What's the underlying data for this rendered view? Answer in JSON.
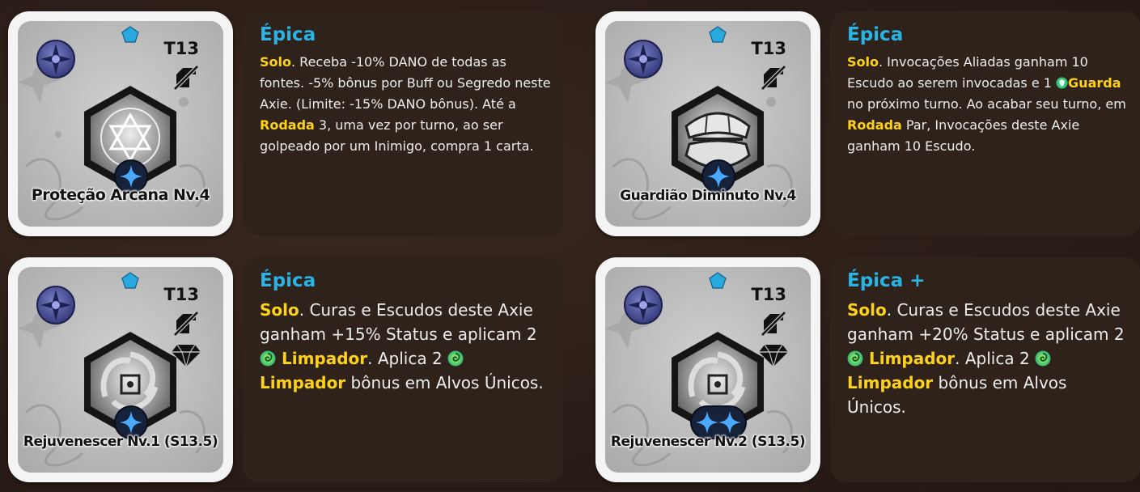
{
  "cards": [
    {
      "name": "Proteção Arcana Nv.4",
      "tier": "T13",
      "rarity": "Épica",
      "art_icon": "star-of-david-icon",
      "level_dots": 1,
      "desc": [
        {
          "t": "Solo",
          "k": true
        },
        {
          "t": ". Receba -10% DANO de todas as fontes. -5% bônus por Buff ou Segredo neste Axie. (Limite: -15% DANO bônus). Até a "
        },
        {
          "t": "Rodada",
          "k": true
        },
        {
          "t": " 3, uma vez por turno, ao ser golpeado por um Inimigo, compra 1 carta."
        }
      ]
    },
    {
      "name": "Guardião Diminuto Nv.4",
      "tier": "T13",
      "rarity": "Épica",
      "art_icon": "shell-mouth-icon",
      "level_dots": 1,
      "desc": [
        {
          "t": "Solo",
          "k": true
        },
        {
          "t": ". Invocações Aliadas ganham 10 Escudo ao serem invocadas e 1 "
        },
        {
          "icon": "guard-icon"
        },
        {
          "t": "Guarda",
          "k": true
        },
        {
          "t": " no próximo turno. Ao acabar seu turno, em "
        },
        {
          "t": "Rodada",
          "k": true
        },
        {
          "t": " Par, Invocações deste Axie ganham 10 Escudo."
        }
      ]
    },
    {
      "name": "Rejuvenescer Nv.1 (S13.5)",
      "tier": "T13",
      "rarity": "Épica",
      "art_icon": "swirl-vortex-icon",
      "level_dots": 1,
      "desc": [
        {
          "t": "Solo",
          "k": true
        },
        {
          "t": ". Curas e Escudos deste Axie ganham +15% Status e aplicam 2 "
        },
        {
          "icon": "cleanse-icon"
        },
        {
          "t": " Limpador",
          "k": true
        },
        {
          "t": ". Aplica 2 "
        },
        {
          "icon": "cleanse-icon"
        },
        {
          "t": " Limpador",
          "k": true
        },
        {
          "t": " bônus em Alvos Únicos."
        }
      ]
    },
    {
      "name": "Rejuvenescer Nv.2 (S13.5)",
      "tier": "T13",
      "rarity": "Épica +",
      "art_icon": "swirl-vortex-icon",
      "level_dots": 2,
      "desc": [
        {
          "t": "Solo",
          "k": true
        },
        {
          "t": ". Curas e Escudos deste Axie ganham +20% Status e aplicam 2 "
        },
        {
          "icon": "cleanse-icon"
        },
        {
          "t": " Limpador",
          "k": true
        },
        {
          "t": ". Aplica 2 "
        },
        {
          "icon": "cleanse-icon"
        },
        {
          "t": " Limpador",
          "k": true
        },
        {
          "t": " bônus em Alvos Únicos."
        }
      ]
    }
  ],
  "colors": {
    "rarity": "#2ab4e6",
    "keyword": "#ffd21a",
    "panel": "#2e221b",
    "gem": "#29a8e0"
  }
}
